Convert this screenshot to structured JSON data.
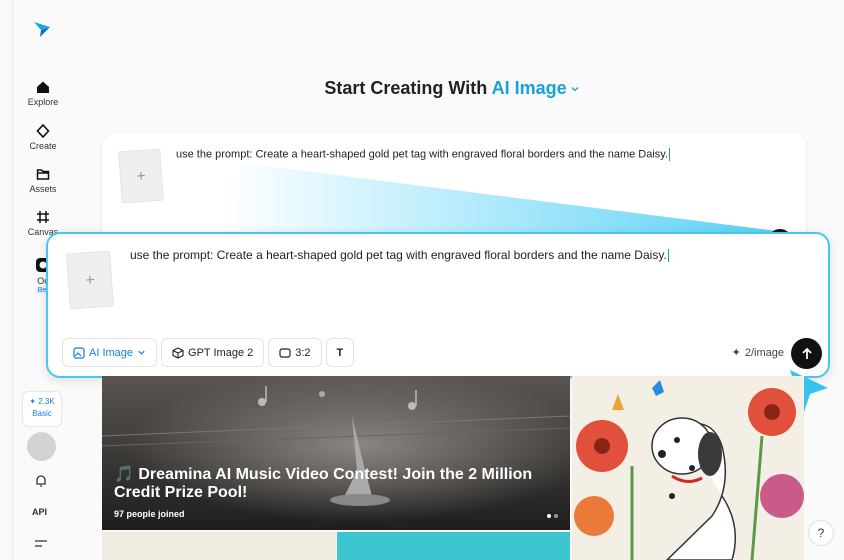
{
  "sidebar": {
    "items": [
      {
        "label": "Explore",
        "icon": "home-icon"
      },
      {
        "label": "Create",
        "icon": "sparkle-icon"
      },
      {
        "label": "Assets",
        "icon": "folder-icon"
      },
      {
        "label": "Canvas",
        "icon": "canvas-icon"
      },
      {
        "label": "Oc",
        "icon": "omni-icon",
        "badge": "Bet"
      }
    ],
    "credits": {
      "amount": "2.3K",
      "plan": "Basic"
    },
    "api_label": "API"
  },
  "header": {
    "title_prefix": "Start Creating With",
    "title_accent": "AI Image"
  },
  "prompt": {
    "text": "use the prompt: Create a heart-shaped gold pet tag with engraved floral borders and the name Daisy.",
    "thumb_plus": "+"
  },
  "toolbar": {
    "mode_label": "AI Image",
    "model_label": "GPT Image 2",
    "ratio_label": "3:2",
    "text_tool": "T",
    "cost_label": "2/image"
  },
  "banner": {
    "title": "🎵 Dreamina AI Music Video Contest! Join the 2 Million Credit Prize Pool!",
    "subtitle": "97 people joined"
  },
  "help_label": "?",
  "colors": {
    "accent": "#14a2d8",
    "highlight_border": "#45c7f2"
  }
}
